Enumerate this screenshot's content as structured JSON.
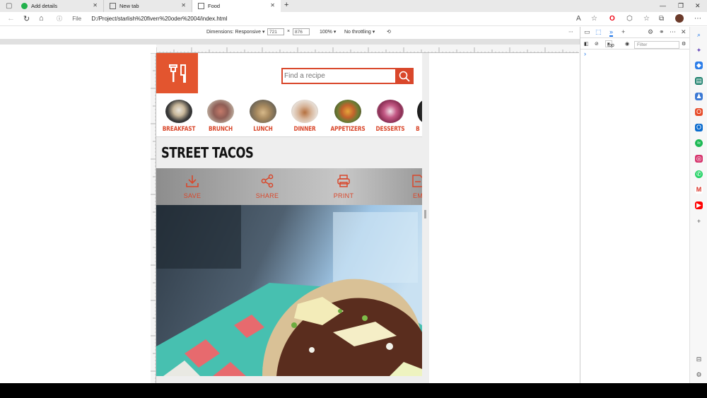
{
  "tabs": [
    {
      "title": "Add details",
      "active": false
    },
    {
      "title": "New tab",
      "active": false
    },
    {
      "title": "Food",
      "active": true
    }
  ],
  "address": {
    "scheme_label": "File",
    "url": "D:/Project/starlish%20fiverr%20oder%2004/index.html"
  },
  "device_toolbar": {
    "dimensions_label": "Dimensions: Responsive",
    "width": "721",
    "times": "×",
    "height": "876",
    "zoom": "100%",
    "throttling": "No throttling"
  },
  "page": {
    "search_placeholder": "Find a recipe",
    "categories": [
      {
        "label": "BREAKFAST"
      },
      {
        "label": "BRUNCH"
      },
      {
        "label": "LUNCH"
      },
      {
        "label": "DINNER"
      },
      {
        "label": "APPETIZERS"
      },
      {
        "label": "DESSERTS"
      },
      {
        "label": "B"
      }
    ],
    "title": "STREET TACOS",
    "actions": [
      {
        "label": "SAVE",
        "icon": "download-icon"
      },
      {
        "label": "SHARE",
        "icon": "share-icon"
      },
      {
        "label": "PRINT",
        "icon": "print-icon"
      },
      {
        "label": "EM",
        "icon": "email-icon"
      }
    ]
  },
  "devtools": {
    "context": "top",
    "filter_placeholder": "Filter",
    "prompt": "›"
  },
  "colors": {
    "accent": "#d9472b",
    "logo_bg": "#e3552f",
    "band": "#eeeeee"
  }
}
